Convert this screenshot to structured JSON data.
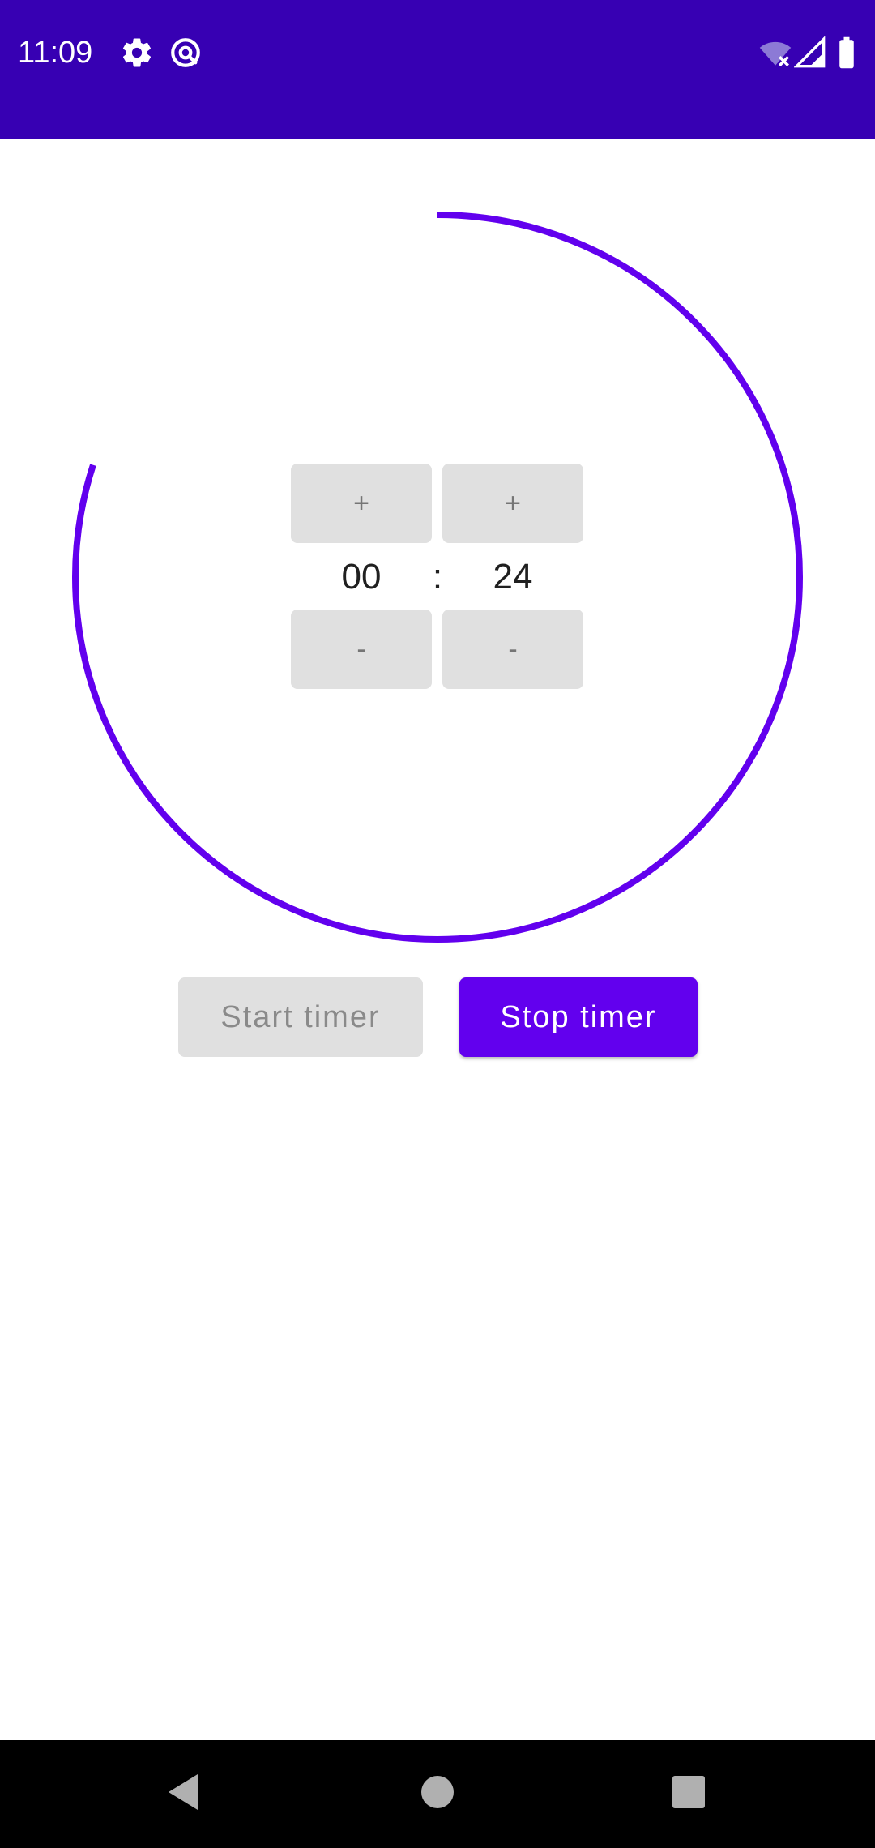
{
  "status_bar": {
    "time": "11:09",
    "background": "#3700b3",
    "icons": [
      "gear-icon",
      "at-sign-icon",
      "wifi-off-icon",
      "signal-icon",
      "battery-icon"
    ]
  },
  "timer": {
    "minutes": "00",
    "separator": ":",
    "seconds": "24",
    "increment_label": "+",
    "decrement_label": "-",
    "progress_fraction": 0.8,
    "ring_color": "#6200ee"
  },
  "actions": {
    "start_label": "Start timer",
    "stop_label": "Stop timer",
    "accent": "#6200ee"
  },
  "nav_bar": {
    "icons": [
      "back-icon",
      "home-icon",
      "recents-icon"
    ]
  }
}
